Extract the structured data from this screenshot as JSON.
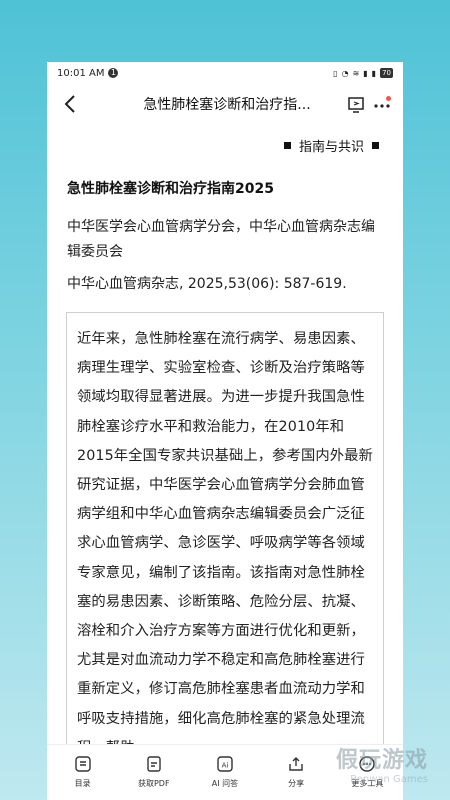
{
  "status_bar": {
    "time": "10:01 AM",
    "notification_count": "1",
    "battery": "70"
  },
  "header": {
    "title": "急性肺栓塞诊断和治疗指..."
  },
  "section_tag": "指南与共识",
  "document": {
    "title": "急性肺栓塞诊断和治疗指南2025",
    "authors": "中华医学会心血管病学分会，中华心血管病杂志编辑委员会",
    "citation": "中华心血管病杂志, 2025,53(06): 587-619.",
    "abstract": "近年来，急性肺栓塞在流行病学、易患因素、病理生理学、实验室检查、诊断及治疗策略等领域均取得显著进展。为进一步提升我国急性肺栓塞诊疗水平和救治能力，在2010年和2015年全国专家共识基础上，参考国内外最新研究证据，中华医学会心血管病学分会肺血管病学组和中华心血管病杂志编辑委员会广泛征求心血管病学、急诊医学、呼吸病学等各领域专家意见，编制了该指南。该指南对急性肺栓塞的易患因素、诊断策略、危险分层、抗凝、溶栓和介入治疗方案等方面进行优化和更新，尤其是对血流动力学不稳定和高危肺栓塞进行重新定义，修订高危肺栓塞患者血流动力学和呼吸支持措施，细化高危肺栓塞的紧急处理流程，帮助"
  },
  "bottom_nav": [
    {
      "label": "目录",
      "icon": "list-icon"
    },
    {
      "label": "获取PDF",
      "icon": "pdf-icon"
    },
    {
      "label": "AI 问答",
      "icon": "ai-icon"
    },
    {
      "label": "分享",
      "icon": "share-icon"
    },
    {
      "label": "更多工具",
      "icon": "more-tools-icon"
    }
  ],
  "watermark": {
    "main": "假玩游戏",
    "sub": "Renwan Games"
  }
}
